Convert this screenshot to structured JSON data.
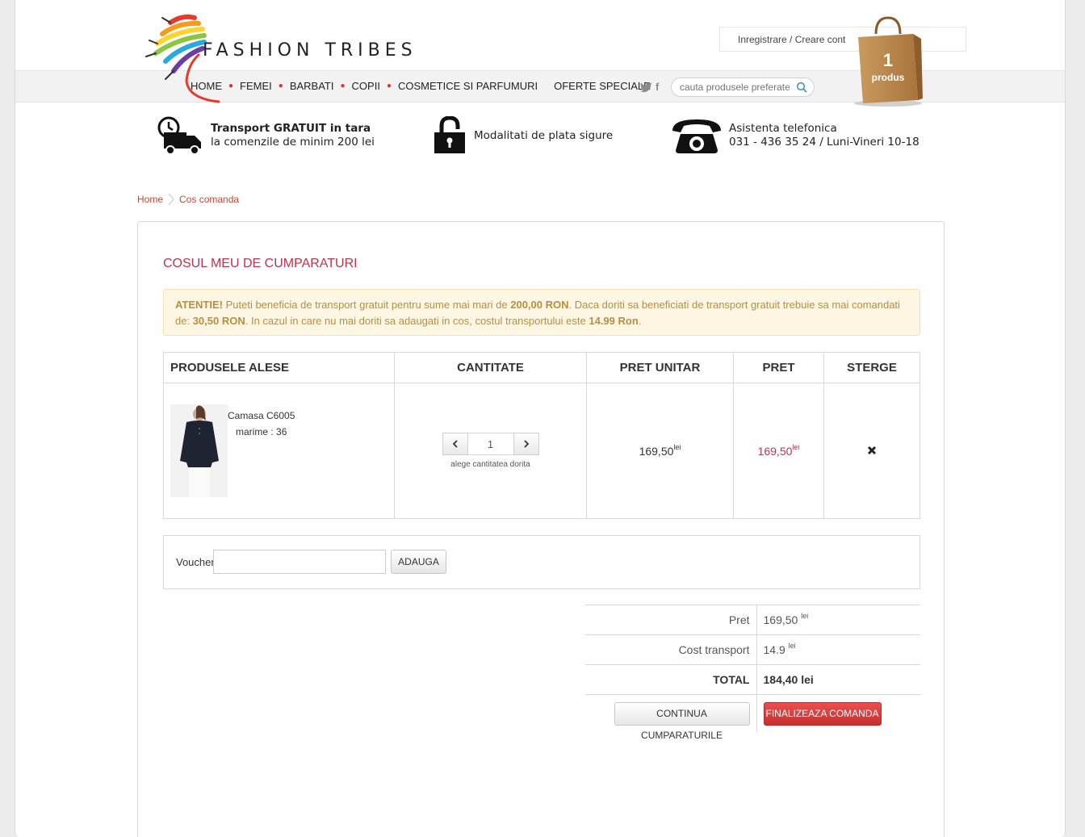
{
  "header": {
    "logo_text": "FASHION TRIBES",
    "nav": [
      "HOME",
      "FEMEI",
      "BARBATI",
      "COPII",
      "COSMETICE SI PARFUMURI",
      "OFERTE SPECIALE"
    ],
    "social": {
      "twitter_icon": "twitter-icon",
      "facebook_label": "f"
    },
    "search_placeholder": "cauta produsele preferate...",
    "account_link": "Inregistrare / Creare cont",
    "cart_count": "1",
    "cart_label": "produs"
  },
  "features": {
    "transport_title": "Transport GRATUIT in tara",
    "transport_sub": "la comenzile de minim 200 lei",
    "payment": "Modalitati de plata sigure",
    "phone_title": "Asistenta telefonica",
    "phone_sub": "031 - 436 35 24 / Luni-Vineri 10-18"
  },
  "breadcrumb": [
    "Home",
    "Cos comanda"
  ],
  "cart": {
    "title": "COSUL MEU DE CUMPARATURI",
    "alert": {
      "lead": "ATENTIE!",
      "t1": " Puteti beneficia de transport gratuit pentru sume mai mari de ",
      "threshold": "200,00 RON",
      "t2": ". Daca doriti sa beneficiati de transport gratuit trebuie sa mai comandati de: ",
      "remaining": "30,50 RON",
      "t3": ". In cazul in care nu mai doriti sa adaugati in cos, costul transportului este ",
      "shipping": "14.99 Ron",
      "t4": "."
    },
    "columns": [
      "PRODUSELE ALESE",
      "CANTITATE",
      "PRET UNITAR",
      "PRET",
      "STERGE"
    ],
    "item": {
      "name": "Camasa C6005",
      "size": "marime : 36",
      "qty": "1",
      "qty_hint": "alege cantitatea dorita",
      "unit_price": "169,50",
      "price": "169,50",
      "currency": "lei"
    },
    "voucher_label": "Voucher",
    "voucher_button": "ADAUGA",
    "totals": {
      "price_label": "Pret",
      "price_value": "169,50",
      "shipping_label": "Cost transport",
      "shipping_value": "14.9",
      "currency": "lei",
      "total_label": "TOTAL",
      "total_value": "184,40 lei"
    },
    "continue_button": "CONTINUA CUMPARATURILE",
    "checkout_button": "FINALIZEAZA COMANDA"
  },
  "colors": {
    "accent_red": "#c3304a",
    "alert_bg": "#fcf6e3",
    "alert_text": "#b98e3f",
    "checkout": "#d63b3a"
  }
}
